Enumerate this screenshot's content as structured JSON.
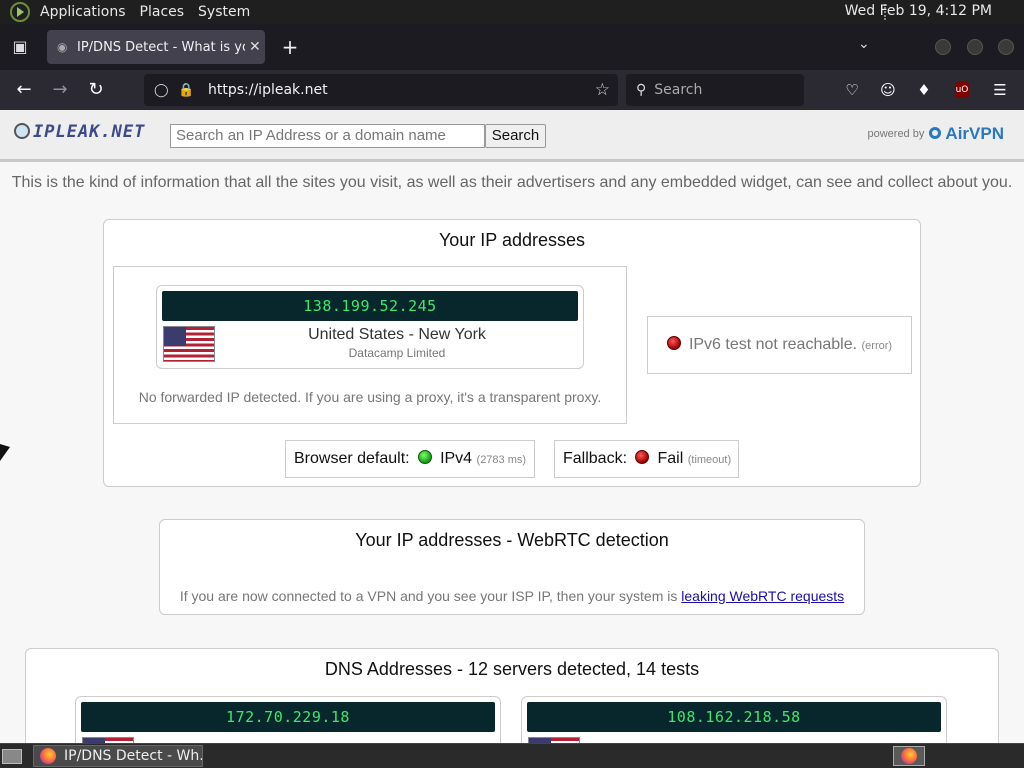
{
  "top_panel": {
    "menus": [
      "Applications",
      "Places",
      "System"
    ],
    "clock": "Wed Feb 19,  4:12 PM"
  },
  "browser": {
    "tab_title": "IP/DNS Detect - What is you",
    "url": "https://ipleak.net",
    "search_placeholder": "Search"
  },
  "site": {
    "logo_text": "IPLEAK.NET",
    "search_placeholder": "Search an IP Address or a domain name",
    "search_button": "Search",
    "powered_by": "powered by",
    "powered_brand": "AirVPN",
    "intro": "This is the kind of information that all the sites you visit, as well as their advertisers and any embedded widget, can see and collect about you."
  },
  "ip_section": {
    "title": "Your IP addresses",
    "ip": "138.199.52.245",
    "country": "United States - New York",
    "isp": "Datacamp Limited",
    "forward_note": "No forwarded IP detected. If you are using a proxy, it's a transparent proxy.",
    "ipv6_text": "IPv6 test not reachable.",
    "ipv6_note": "(error)",
    "browser_default_label": "Browser default:",
    "browser_default_value": "IPv4",
    "browser_default_time": "(2783 ms)",
    "fallback_label": "Fallback:",
    "fallback_value": "Fail",
    "fallback_note": "(timeout)"
  },
  "webrtc": {
    "title": "Your IP addresses - WebRTC detection",
    "note": "If you are now connected to a VPN and you see your ISP IP, then your system is",
    "link": "leaking WebRTC requests"
  },
  "dns": {
    "title": "DNS Addresses - 12 servers detected, 14 tests",
    "servers": [
      {
        "ip": "172.70.229.18"
      },
      {
        "ip": "108.162.218.58"
      }
    ]
  },
  "taskbar": {
    "task_title": "IP/DNS Detect - Wh..."
  },
  "colors": {
    "ip_display_bg": "#08272c",
    "ip_display_text": "#3ce86a",
    "status_ok": "#109a10",
    "status_fail": "#9b0000"
  },
  "icons": [
    "menu-logo-icon",
    "tab-list-icon",
    "globe-icon",
    "close-icon",
    "plus-icon",
    "chevron-down-icon",
    "back-arrow-icon",
    "forward-arrow-icon",
    "reload-icon",
    "shield-icon",
    "lock-icon",
    "star-icon",
    "search-icon",
    "pocket-icon",
    "account-icon",
    "extensions-icon",
    "ublock-icon",
    "hamburger-menu-icon",
    "firefox-icon"
  ]
}
